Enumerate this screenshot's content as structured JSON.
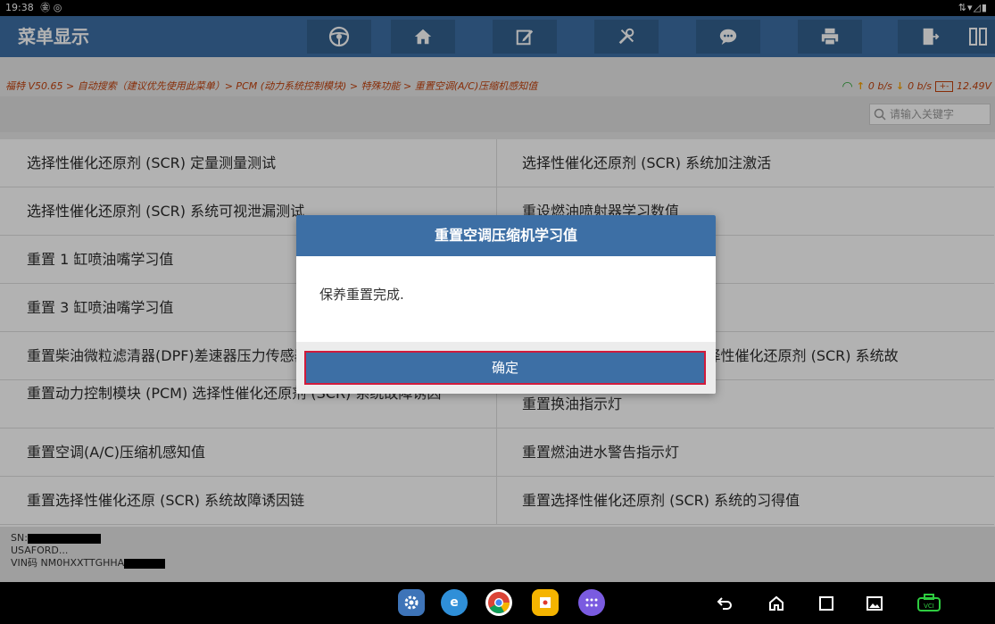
{
  "status_bar": {
    "time": "19:38",
    "left_icons": "㊎ ◎",
    "right_icons": "⇅▾◿▮"
  },
  "app": {
    "title": "菜单显示"
  },
  "toolbar": {
    "icons": [
      "steering-wheel-icon",
      "home-icon",
      "edit-icon",
      "diagnostic-tools-icon",
      "message-icon",
      "print-icon",
      "exit-icon",
      "split-view-icon"
    ]
  },
  "breadcrumb": {
    "text": "福特 V50.65 > 自动搜索（建议优先使用此菜单）> PCM (动力系统控制模块) > 特殊功能 > 重置空调(A/C)压缩机感知值"
  },
  "network": {
    "upload": "0 b/s",
    "download": "0 b/s",
    "voltage": "12.49V"
  },
  "search": {
    "placeholder": "请输入关键字"
  },
  "menu": {
    "left": [
      "选择性催化还原剂 (SCR) 定量测量测试",
      "选择性催化还原剂 (SCR) 系统可视泄漏测试",
      "重置 1 缸喷油嘴学习值",
      "重置 3 缸喷油嘴学习值",
      "重置柴油微粒滤清器(DPF)差速器压力传感器",
      "重置动力控制模块 (PCM) 选择性催化还原剂 (SCR) 系统故障诱因",
      "重置空调(A/C)压缩机感知值",
      "重置选择性催化还原 (SCR) 系统故障诱因链"
    ],
    "right": [
      "选择性催化还原剂 (SCR) 系统加注激活",
      "重设燃油喷射器学习数值",
      "",
      "",
      "重置氮氧化物(NOx)传感器选择性催化还原剂 (SCR) 系统故",
      "重置换油指示灯",
      "重置燃油进水警告指示灯",
      "重置选择性催化还原剂 (SCR) 系统的习得值"
    ]
  },
  "vehicle": {
    "sn_label": "SN:",
    "make": "USAFORD...",
    "vin_label": "VIN码 NM0HXXTTGHHA"
  },
  "dialog": {
    "title": "重置空调压缩机学习值",
    "message": "保养重置完成.",
    "ok_label": "确定"
  },
  "nav_bar": {
    "apps": [
      "settings-app-icon",
      "browser-app-icon",
      "chrome-app-icon",
      "media-app-icon",
      "app-drawer-icon"
    ],
    "buttons": [
      "back-icon",
      "home-nav-icon",
      "recents-icon",
      "screenshot-icon",
      "vci-icon"
    ],
    "vci_label": "VCI"
  }
}
